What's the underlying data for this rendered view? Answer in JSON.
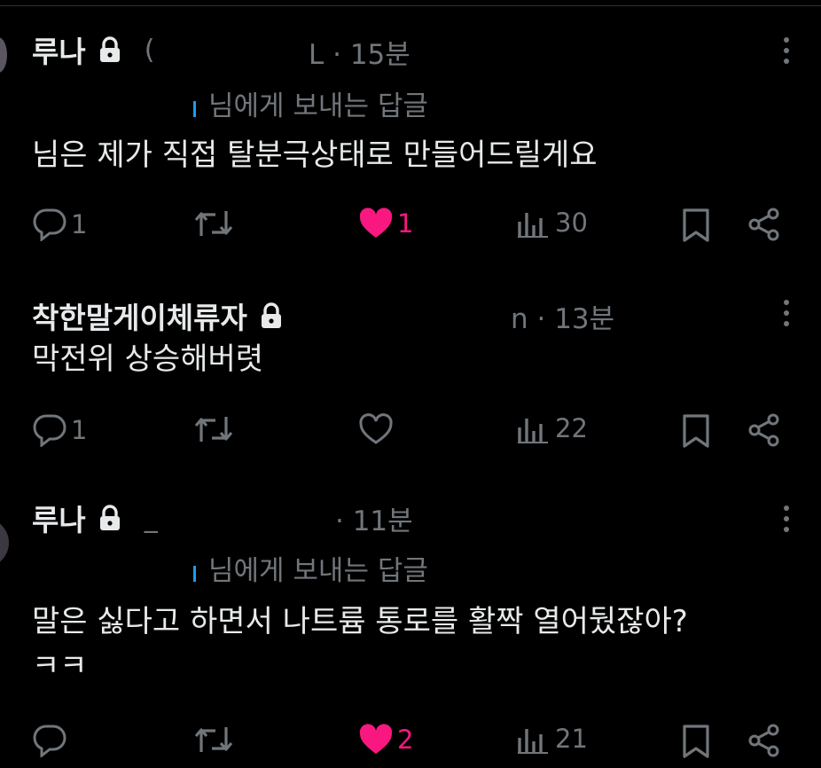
{
  "tweets": [
    {
      "name": "루나",
      "handle": "(",
      "meta": "L · 15분",
      "reply_to": "님에게 보내는 답글",
      "text": [
        "님은 제가 직접 탈분극상태로 만들어드릴게요"
      ],
      "replies": "1",
      "retweets": "",
      "likes": "1",
      "liked": true,
      "views": "30"
    },
    {
      "name": "착한말게이체류자",
      "handle": "",
      "meta": "n · 13분",
      "reply_to": "",
      "text": [
        "막전위 상승해버렷"
      ],
      "replies": "1",
      "retweets": "",
      "likes": "",
      "liked": false,
      "views": "22"
    },
    {
      "name": "루나",
      "handle": "_",
      "meta": "· 11분",
      "reply_to": "님에게 보내는 답글",
      "text": [
        "말은 싫다고 하면서 나트륨 통로를 활짝 열어뒀잖아?",
        "ㅋㅋ"
      ],
      "replies": "",
      "retweets": "",
      "likes": "2",
      "liked": true,
      "views": "21"
    }
  ],
  "icons": {
    "reply": "reply-icon",
    "retweet": "retweet-icon",
    "like": "heart-icon",
    "views": "views-icon",
    "bookmark": "bookmark-icon",
    "share": "share-icon",
    "lock": "lock-icon",
    "more": "more-dots-icon"
  },
  "colors": {
    "background": "#000000",
    "text": "#e7e9ea",
    "muted": "#71767b",
    "like": "#f91880",
    "accent": "#1d9bf0"
  }
}
